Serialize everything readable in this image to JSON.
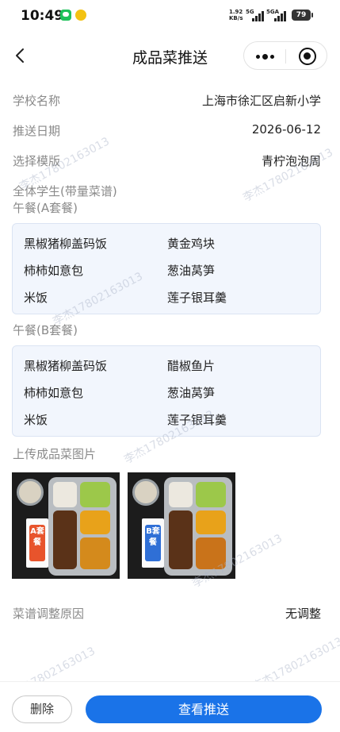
{
  "status_bar": {
    "time": "10:49",
    "net_speed_value": "1.92",
    "net_speed_unit": "KB/s",
    "signal1_label": "5G",
    "signal2_label": "5GA",
    "battery": "79"
  },
  "nav": {
    "title": "成品菜推送",
    "back_icon": "chevron-left-icon",
    "more_icon": "more-dots-icon",
    "target_icon": "target-icon"
  },
  "fields": {
    "school": {
      "label": "学校名称",
      "value": "上海市徐汇区启新小学"
    },
    "date": {
      "label": "推送日期",
      "value": "2026-06-12"
    },
    "template": {
      "label": "选择模版",
      "value": "青柠泡泡周"
    }
  },
  "group_title": "全体学生(带量菜谱)",
  "meal_a": {
    "title": "午餐(A套餐)",
    "items": [
      "黑椒猪柳盖码饭",
      "黄金鸡块",
      "柿柿如意包",
      "葱油莴笋",
      "米饭",
      "莲子银耳羹"
    ]
  },
  "meal_b": {
    "title": "午餐(B套餐)",
    "items": [
      "黑椒猪柳盖码饭",
      "醋椒鱼片",
      "柿柿如意包",
      "葱油莴笋",
      "米饭",
      "莲子银耳羹"
    ]
  },
  "upload": {
    "label": "上传成品菜图片",
    "photos": [
      {
        "card_text": "A套餐",
        "card_color": "#e8542c"
      },
      {
        "card_text": "B套餐",
        "card_color": "#2f6fd6"
      }
    ]
  },
  "adjust": {
    "label": "菜谱调整原因",
    "value": "无调整"
  },
  "watermark": "李杰17802163013",
  "actions": {
    "delete": "删除",
    "view": "查看推送"
  },
  "colors": {
    "primary": "#1a73e8",
    "menu_bg": "#f2f6fd",
    "label_gray": "#8a8a8a"
  }
}
